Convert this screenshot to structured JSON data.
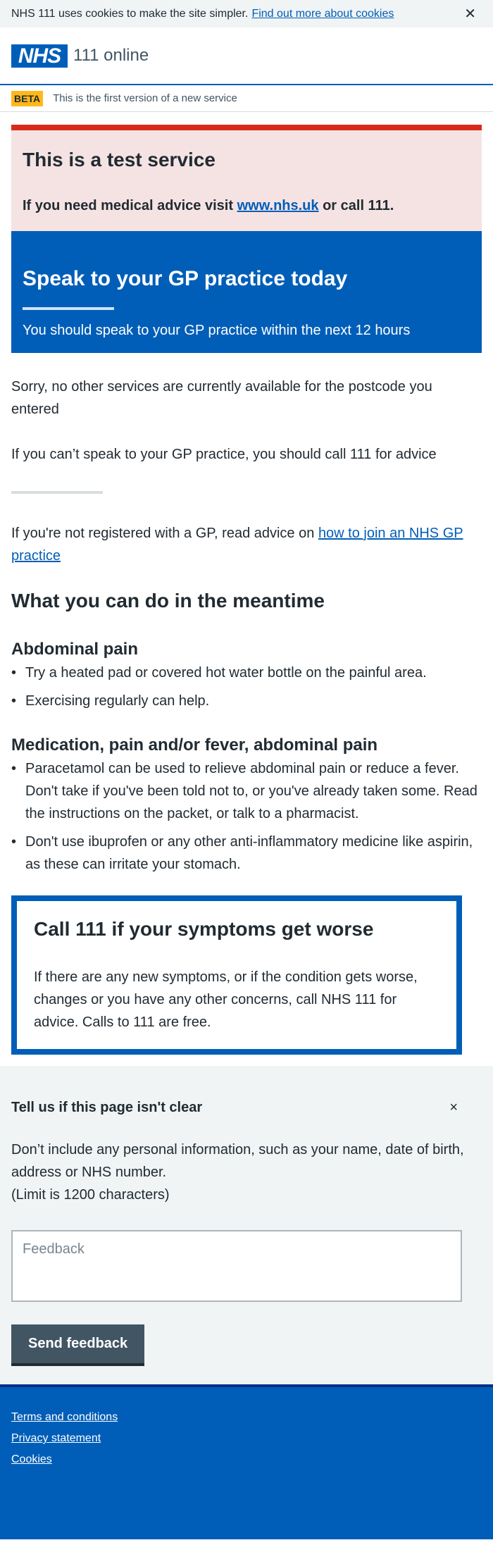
{
  "cookie_bar": {
    "text": "NHS 111 uses cookies to make the site simpler.",
    "link": "Find out more about cookies",
    "close_glyph": "✕"
  },
  "header": {
    "logo_text": "NHS",
    "service_name": "111 online"
  },
  "beta": {
    "tag": "BETA",
    "text": "This is the first version of a new service"
  },
  "test_banner": {
    "title": "This is a test service",
    "text_before": "If you need medical advice visit",
    "link": "www.nhs.uk",
    "text_after": "or call 111."
  },
  "gp_box": {
    "title": "Speak to your GP practice today",
    "subtitle": "You should speak to your GP practice within the next 12 hours"
  },
  "main": {
    "sorry": "Sorry, no other services are currently available for the postcode you entered",
    "cant_speak": "If you can’t speak to your GP practice, you should call 111 for advice",
    "registered_before": "If you're not registered with a GP, read advice on",
    "registered_link": "how to join an NHS GP practice",
    "meantime": "What you can do in the meantime",
    "sections": [
      {
        "title": "Abdominal pain",
        "items": [
          "Try a heated pad or covered hot water bottle on the painful area.",
          "Exercising regularly can help."
        ]
      },
      {
        "title": "Medication, pain and/or fever, abdominal pain",
        "items": [
          "Paracetamol can be used to relieve abdominal pain or reduce a fever. Don't take if you've been told not to, or you've already taken some. Read the instructions on the packet, or talk to a pharmacist.",
          "Don't use ibuprofen or any other anti-inflammatory medicine like aspirin, as these can irritate your stomach."
        ]
      }
    ]
  },
  "call_box": {
    "title": "Call 111 if your symptoms get worse",
    "text": "If there are any new symptoms, or if the condition gets worse, changes or you have any other concerns, call NHS 111 for advice. Calls to 111 are free."
  },
  "feedback": {
    "title": "Tell us if this page isn't clear",
    "close_glyph": "×",
    "warning": "Don’t include any personal information, such as your name, date of birth, address or NHS number.",
    "limit": "(Limit is 1200 characters)",
    "placeholder": "Feedback",
    "button": "Send feedback"
  },
  "footer": {
    "links": [
      "Terms and conditions",
      "Privacy statement",
      "Cookies"
    ]
  },
  "colors": {
    "nhs_blue": "#005eb8",
    "red": "#da291c",
    "beta_yellow": "#ffb81c",
    "grey_bg": "#f0f4f5",
    "button_grey": "#425563"
  }
}
